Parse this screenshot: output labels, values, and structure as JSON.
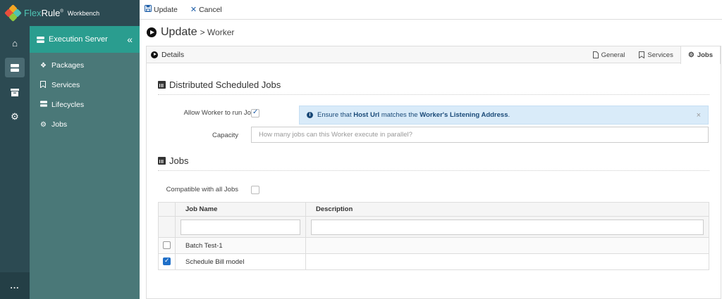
{
  "app": {
    "brand_flex": "Flex",
    "brand_rule": "Rule",
    "brand_reg": "®",
    "brand_sub": "Workbench",
    "colors": {
      "rail": "#2c4a52",
      "nav": "#4a7878",
      "nav_header": "#2a9d8f",
      "accent": "#1f6fc8"
    }
  },
  "rail": {
    "items": [
      {
        "name": "home-icon"
      },
      {
        "name": "server-icon"
      },
      {
        "name": "archive-icon"
      },
      {
        "name": "gear-icon"
      }
    ],
    "more_label": "..."
  },
  "nav": {
    "header": "Execution Server",
    "collapse_glyph": "«",
    "items": [
      {
        "label": "Packages",
        "icon": "cubes-icon"
      },
      {
        "label": "Services",
        "icon": "bookmark-icon"
      },
      {
        "label": "Lifecycles",
        "icon": "server-icon"
      },
      {
        "label": "Jobs",
        "icon": "cogs-icon"
      }
    ]
  },
  "toolbar": {
    "update_label": "Update",
    "cancel_label": "Cancel"
  },
  "page": {
    "title": "Update",
    "subtitle": "> Worker"
  },
  "details": {
    "label": "Details",
    "tabs": [
      {
        "label": "General",
        "active": false
      },
      {
        "label": "Services",
        "active": false
      },
      {
        "label": "Jobs",
        "active": true
      }
    ]
  },
  "distributed": {
    "title": "Distributed Scheduled Jobs",
    "allow_label": "Allow Worker to run Jobs",
    "allow_checked": true,
    "alert_prefix": "Ensure that ",
    "alert_b1": "Host Url",
    "alert_mid": " matches the ",
    "alert_b2": "Worker's Listening Address",
    "alert_suffix": ".",
    "alert_close": "×",
    "capacity_label": "Capacity",
    "capacity_value": "",
    "capacity_placeholder": "How many jobs can this Worker execute in parallel?"
  },
  "jobs": {
    "title": "Jobs",
    "compatible_label": "Compatible with all Jobs",
    "compatible_checked": false,
    "columns": [
      "Job Name",
      "Description"
    ],
    "filters": {
      "name": "",
      "description": ""
    },
    "rows": [
      {
        "name": "Batch Test-1",
        "description": "",
        "checked": false
      },
      {
        "name": "Schedule Bill model",
        "description": "",
        "checked": true
      }
    ]
  }
}
